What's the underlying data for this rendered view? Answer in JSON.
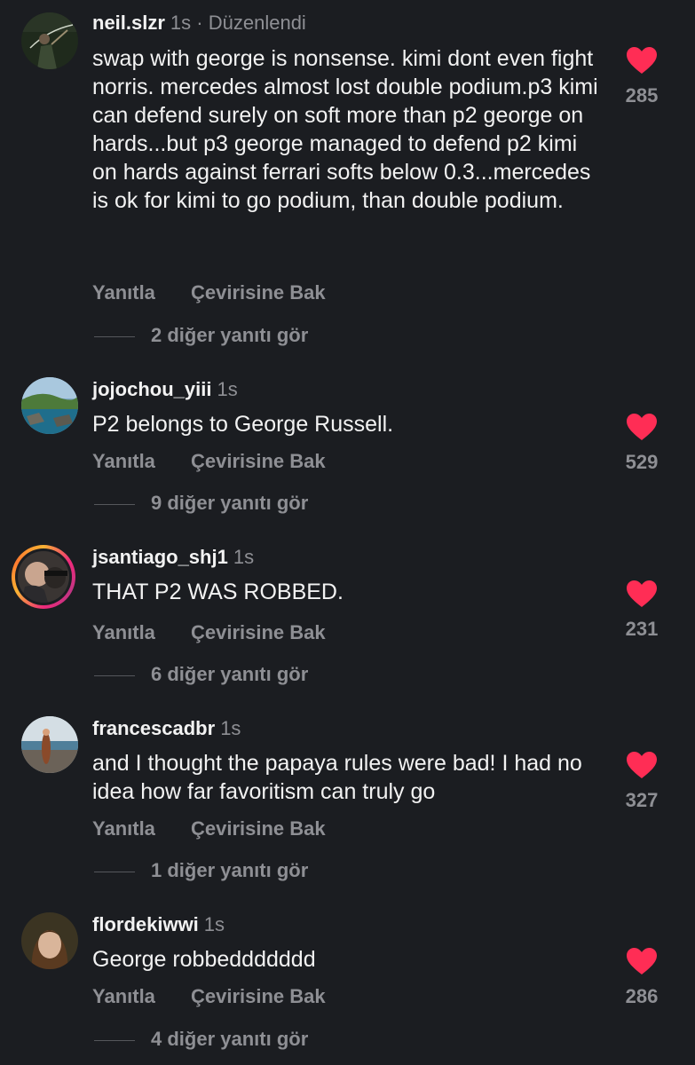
{
  "ui": {
    "reply_label": "Yanıtla",
    "translate_label": "Çevirisine Bak",
    "heart_color": "#ff2d55"
  },
  "comments": [
    {
      "username": "neil.slzr",
      "time": "1s",
      "edited": "· Düzenlendi",
      "text": "swap with george is nonsense. kimi dont even fight norris. mercedes almost lost double podium.p3 kimi can defend surely on soft more than p2 george on hards...but p3 george managed to defend p2 kimi on hards against ferrari softs below 0.3...mercedes is ok for kimi to go podium, than double podium.",
      "likes": "285",
      "replies": "2 diğer yanıtı gör"
    },
    {
      "username": "jojochou_yiii",
      "time": "1s",
      "text": "P2 belongs to George Russell.",
      "likes": "529",
      "replies": "9 diğer yanıtı gör"
    },
    {
      "username": "jsantiago_shj1",
      "time": "1s",
      "text": "THAT P2 WAS ROBBED.",
      "likes": "231",
      "replies": "6 diğer yanıtı gör"
    },
    {
      "username": "francescadbr",
      "time": "1s",
      "text": "and I thought the papaya rules were bad! I had no idea how far favoritism can truly go",
      "likes": "327",
      "replies": "1 diğer yanıtı gör"
    },
    {
      "username": "flordekiwwi",
      "time": "1s",
      "text": "George robbeddddddd",
      "likes": "286",
      "replies": "4 diğer yanıtı gör"
    }
  ]
}
